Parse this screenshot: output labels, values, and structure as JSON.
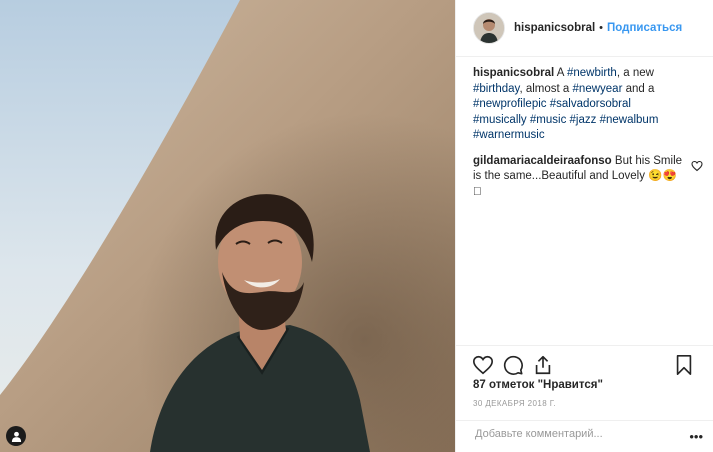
{
  "post": {
    "username": "hispanicsobral",
    "follow_label": "Подписаться",
    "separator": "•"
  },
  "caption": {
    "author": "hispanicsobral",
    "parts": [
      {
        "text": "A ",
        "tag": false
      },
      {
        "text": "#newbirth",
        "tag": true
      },
      {
        "text": ", a new ",
        "tag": false
      },
      {
        "text": "#birthday",
        "tag": true
      },
      {
        "text": ", almost a ",
        "tag": false
      },
      {
        "text": "#newyear",
        "tag": true
      },
      {
        "text": " and a ",
        "tag": false
      },
      {
        "text": "#newprofilepic",
        "tag": true
      },
      {
        "text": " ",
        "tag": false
      },
      {
        "text": "#salvadorsobral",
        "tag": true
      },
      {
        "text": " ",
        "tag": false
      },
      {
        "text": "#musically",
        "tag": true
      },
      {
        "text": " ",
        "tag": false
      },
      {
        "text": "#music",
        "tag": true
      },
      {
        "text": " ",
        "tag": false
      },
      {
        "text": "#jazz",
        "tag": true
      },
      {
        "text": " ",
        "tag": false
      },
      {
        "text": "#newalbum",
        "tag": true
      },
      {
        "text": " ",
        "tag": false
      },
      {
        "text": "#warnermusic",
        "tag": true
      }
    ]
  },
  "comment": {
    "author": "gildamariacaldeiraafonso",
    "text": "But his Smile is the same...Beautiful and Lovely 😉😍􏿾"
  },
  "likes_text": "87 отметок \"Нравится\"",
  "date_text": "30 ДЕКАБРЯ 2018 Г.",
  "add_comment_placeholder": "Добавьте комментарий...",
  "more_label": "•••",
  "icons": {
    "like": "heart-icon",
    "comment": "comment-bubble-icon",
    "share": "share-icon",
    "save": "bookmark-icon",
    "user_tag": "person-icon",
    "comment_like": "heart-icon"
  },
  "colors": {
    "link": "#003569",
    "follow": "#3897f0",
    "border": "#efefef",
    "muted": "#999999"
  }
}
